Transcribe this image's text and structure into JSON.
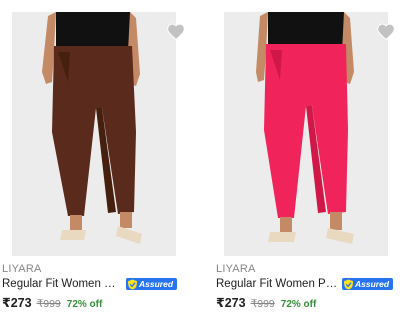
{
  "products": [
    {
      "brand": "LIYARA",
      "title": "Regular Fit Women Brown Cotton Trousers",
      "badge": "Assured",
      "price": "₹273",
      "mrp": "₹999",
      "discount": "72% off",
      "pant_color": "#5a2a1c",
      "pant_shade": "#46200f"
    },
    {
      "brand": "LIYARA",
      "title": "Regular Fit Women Pink Cotton Trousers",
      "badge": "Assured",
      "price": "₹273",
      "mrp": "₹999",
      "discount": "72% off",
      "pant_color": "#f0245a",
      "pant_shade": "#d01747"
    }
  ],
  "colors": {
    "brand_text": "#878787",
    "title_text": "#212121",
    "assured_blue": "#2874f0",
    "discount_green": "#388e3c",
    "image_bg": "#ececec"
  },
  "icons": {
    "wishlist": "heart-icon",
    "assured": "shield-icon"
  }
}
